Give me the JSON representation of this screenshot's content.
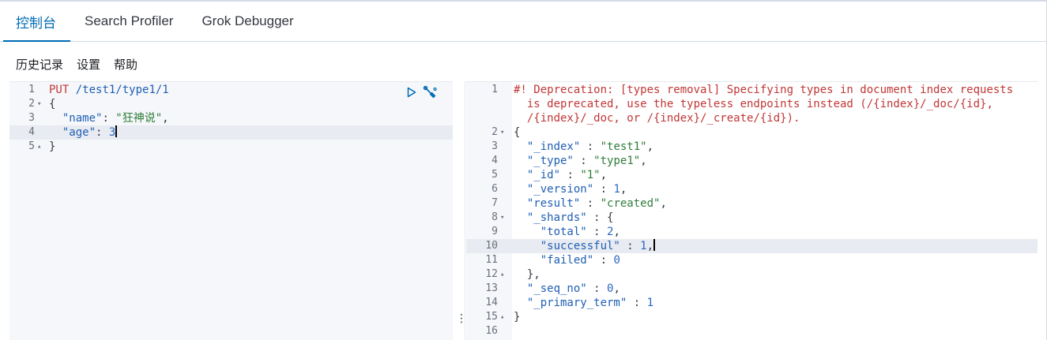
{
  "tabs": [
    {
      "label": "控制台",
      "active": true
    },
    {
      "label": "Search Profiler",
      "active": false
    },
    {
      "label": "Grok Debugger",
      "active": false
    }
  ],
  "toolbar": {
    "history": "历史记录",
    "settings": "设置",
    "help": "帮助"
  },
  "request_editor": {
    "line_numbers": [
      "1",
      "2",
      "3",
      "4",
      "5"
    ],
    "method": "PUT",
    "url": "/test1/type1/1",
    "open_brace": "{",
    "close_brace": "}",
    "field_name_key": "\"name\"",
    "field_name_value": "\"狂神说\"",
    "field_age_key": "\"age\"",
    "field_age_value": "3",
    "colon": ": ",
    "comma": ","
  },
  "response_editor": {
    "line_numbers": [
      "1",
      "",
      "",
      "2",
      "3",
      "4",
      "5",
      "6",
      "7",
      "8",
      "9",
      "10",
      "11",
      "12",
      "13",
      "14",
      "15",
      "16"
    ],
    "deprecation_lines": [
      "#! Deprecation: [types removal] Specifying types in document index requests",
      "  is deprecated, use the typeless endpoints instead (/{index}/_doc/{id},",
      "  /{index}/_doc, or /{index}/_create/{id})."
    ],
    "json_lines": [
      "{",
      "  \"_index\" : \"test1\",",
      "  \"_type\" : \"type1\",",
      "  \"_id\" : \"1\",",
      "  \"_version\" : 1,",
      "  \"result\" : \"created\",",
      "  \"_shards\" : {",
      "    \"total\" : 2,",
      "    \"successful\" : 1,",
      "    \"failed\" : 0",
      "  },",
      "  \"_seq_no\" : 0,",
      "  \"_primary_term\" : 1",
      "}",
      ""
    ]
  },
  "icons": {
    "run": "play-icon",
    "actions": "wrench-icon",
    "resize": "vertical-ellipsis-icon"
  },
  "colors": {
    "accent": "#006bb4",
    "method": "#c13737",
    "key": "#1f5fb4",
    "string": "#2f7d3a",
    "gutter": "#f5f7fa",
    "highlight": "#e8ebf1"
  }
}
